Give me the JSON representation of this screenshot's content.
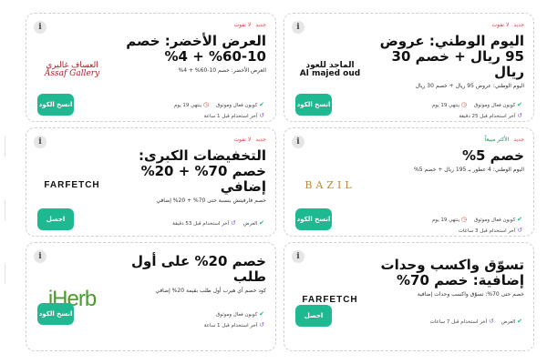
{
  "cards": [
    {
      "tags": {
        "new": "جديد",
        "missing": "لا تفوت"
      },
      "brand": "Al majed oud",
      "brand_ar": "الماجد للعود",
      "title": "اليوم الوطني: عروض 95 ريال + خصم 30 ريال",
      "desc": "اليوم الوطني: عروض 95 ريال + خصم 30 ريال",
      "button": "انسخ الكود",
      "meta_verified": "كوبون فعال وموثوق",
      "meta_ends": "ينتهي 19 يوم",
      "meta_last_used": "آخر استخدام قبل 25 دقيقة"
    },
    {
      "tags": {
        "new": "جديد",
        "missing": "لا تفوت"
      },
      "brand": "Assaf Gallery",
      "brand_ar": "العساف غاليري",
      "title": "العرض الأخضر: خصم 10-60% + 4%",
      "desc": "العرض الأخضر: خصم 10-60% + 4%",
      "button": "انسخ الكود",
      "meta_verified": "كوبون فعال وموثوق",
      "meta_ends": "ينتهي 19 يوم",
      "meta_last_used": "آخر استخدام قبل 1 ساعة"
    },
    {
      "tags": {
        "new": "جديد",
        "popular": "الأكثر مبيعاً"
      },
      "brand": "BAZIL",
      "title": "خصم 5%",
      "desc": "اليوم الوطني: 4 عطور بـ 195 ريال + خصم 5%",
      "button": "انسخ الكود",
      "meta_verified": "كوبون فعال وموثوق",
      "meta_ends": "ينتهي 19 يوم",
      "meta_last_used": "آخر استخدام قبل 3 ساعات"
    },
    {
      "tags": {
        "new": "جديد",
        "missing": "لا تفوت"
      },
      "brand": "FARFETCH",
      "title": "التخفيضات الكبرى: خصم 70% + 20% إضافي",
      "desc": "خصم فارفيتش بنسبة حتى 70% + 20% إضافي",
      "button": "احصل",
      "meta_offer": "العرض",
      "meta_last_used": "آخر استخدام قبل 53 دقيقة"
    },
    {
      "tags": {},
      "brand": "FARFETCH",
      "title": "تسوّق واكسب وحدات إضافية: خصم 70%",
      "desc": "خصم حتى 70%: تسوّق واكسب وحدات إضافية",
      "button": "احصل",
      "meta_offer": "العرض",
      "meta_last_used": "آخر استخدام قبل 7 ساعات"
    },
    {
      "tags": {},
      "brand": "iHerb",
      "title": "خصم 20% على أول طلب",
      "desc": "كود خصم أي هيرب أول طلب بقيمة 20% إضافي",
      "button": "انسخ الكود",
      "meta_verified": "كوبون فعال وموثوق",
      "meta_last_used": "آخر استخدام قبل 1 ساعة"
    }
  ],
  "colors": {
    "accent": "#1fb991",
    "danger": "#e23b3b",
    "history": "#8a5bd6"
  },
  "icons": {
    "info": "i",
    "check": "✔",
    "clock": "◷",
    "history": "↺"
  }
}
